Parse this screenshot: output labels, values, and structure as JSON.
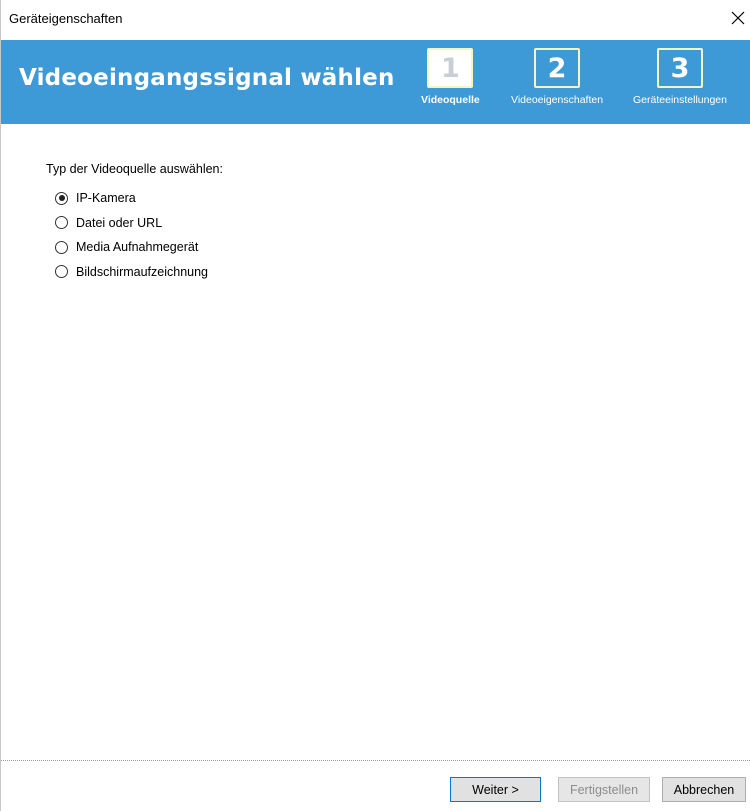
{
  "window": {
    "title": "Geräteigenschaften",
    "close_icon": "close-icon"
  },
  "banner": {
    "heading": "Videoeingangssignal wählen",
    "color": "#3e9ad6",
    "steps": [
      {
        "number": "1",
        "label": "Videoquelle",
        "active": true
      },
      {
        "number": "2",
        "label": "Videoeigenschaften",
        "active": false
      },
      {
        "number": "3",
        "label": "Geräteeinstellungen",
        "active": false
      }
    ]
  },
  "source_type": {
    "label": "Typ der Videoquelle auswählen:",
    "options": [
      {
        "label": "IP-Kamera",
        "checked": true
      },
      {
        "label": "Datei oder URL",
        "checked": false
      },
      {
        "label": "Media Aufnahmegerät",
        "checked": false
      },
      {
        "label": "Bildschirmaufzeichnung",
        "checked": false
      }
    ]
  },
  "footer": {
    "next_label": "Weiter >",
    "finish_label": "Fertigstellen",
    "cancel_label": "Abbrechen"
  }
}
